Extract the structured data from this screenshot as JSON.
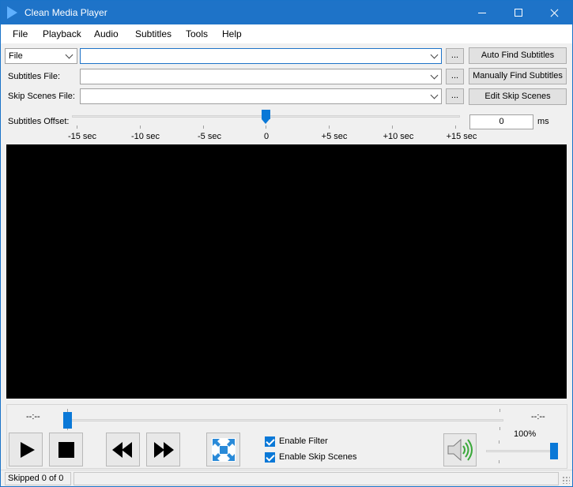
{
  "window": {
    "title": "Clean Media Player"
  },
  "menu": {
    "items": [
      "File",
      "Playback",
      "Audio",
      "Subtitles",
      "Tools",
      "Help"
    ]
  },
  "file_row": {
    "source_select": "File",
    "path_value": "",
    "browse_label": "...",
    "action_label": "Auto Find Subtitles"
  },
  "subtitles_row": {
    "label": "Subtitles File:",
    "path_value": "",
    "browse_label": "...",
    "action_label": "Manually Find Subtitles"
  },
  "skip_row": {
    "label": "Skip Scenes File:",
    "path_value": "",
    "browse_label": "...",
    "action_label": "Edit Skip Scenes"
  },
  "offset": {
    "label": "Subtitles Offset:",
    "ticks": [
      "-15 sec",
      "-10 sec",
      "-5 sec",
      "0",
      "+5 sec",
      "+10 sec",
      "+15 sec"
    ],
    "value": "0",
    "unit": "ms",
    "slider_value_sec": 0
  },
  "playback": {
    "elapsed": "--:--",
    "remaining": "--:--",
    "seek_fraction": 0
  },
  "options": {
    "enable_filter": {
      "label": "Enable Filter",
      "checked": true
    },
    "enable_skip_scenes": {
      "label": "Enable Skip Scenes",
      "checked": true
    }
  },
  "volume": {
    "percent_text": "100%",
    "level_percent": 100
  },
  "status": {
    "text": "Skipped 0 of 0"
  },
  "colors": {
    "title_bar": "#1e73c8",
    "accent": "#0a78d7",
    "video_bg": "#000000"
  },
  "icons": {
    "app": "play-triangle-icon",
    "play": "play-icon",
    "stop": "stop-icon",
    "rewind": "rewind-icon",
    "fast_forward": "fast-forward-icon",
    "fullscreen": "fullscreen-icon",
    "speaker": "speaker-icon"
  }
}
